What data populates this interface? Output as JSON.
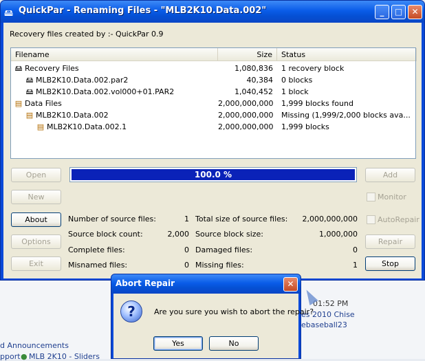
{
  "window": {
    "title": "QuickPar - Renaming Files - \"MLB2K10.Data.002\"",
    "created_by": "Recovery files created by :- QuickPar 0.9",
    "controls": {
      "minimize": "_",
      "maximize": "□",
      "close": "✕"
    }
  },
  "list": {
    "columns": {
      "filename": "Filename",
      "size": "Size",
      "status": "Status"
    },
    "rows": [
      {
        "icon": "disk-icon",
        "name": "Recovery Files",
        "size": "1,080,836",
        "status": "1 recovery block",
        "indent": 0
      },
      {
        "icon": "disk-icon",
        "name": "MLB2K10.Data.002.par2",
        "size": "40,384",
        "status": "0 blocks",
        "indent": 1
      },
      {
        "icon": "disk-icon",
        "name": "MLB2K10.Data.002.vol000+01.PAR2",
        "size": "1,040,452",
        "status": "1 block",
        "indent": 1
      },
      {
        "icon": "document-icon",
        "name": "Data Files",
        "size": "2,000,000,000",
        "status": "1,999 blocks found",
        "indent": 0
      },
      {
        "icon": "document-icon",
        "name": "MLB2K10.Data.002",
        "size": "2,000,000,000",
        "status": "Missing (1,999/2,000 blocks ava...",
        "indent": 1
      },
      {
        "icon": "document-icon",
        "name": "MLB2K10.Data.002.1",
        "size": "2,000,000,000",
        "status": "1,999 blocks",
        "indent": 2
      }
    ]
  },
  "buttons": {
    "open": "Open",
    "new": "New",
    "about": "About",
    "options": "Options",
    "exit": "Exit",
    "add": "Add",
    "repair": "Repair",
    "stop": "Stop"
  },
  "checkboxes": {
    "monitor": "Monitor",
    "autorepair": "AutoRepair"
  },
  "progress": {
    "value": 100.0,
    "label": "100.0 %"
  },
  "stats": {
    "source_files_label": "Number of source files:",
    "source_files": "1",
    "block_count_label": "Source block count:",
    "block_count": "2,000",
    "complete_label": "Complete files:",
    "complete": "0",
    "misnamed_label": "Misnamed files:",
    "misnamed": "0",
    "total_size_label": "Total size of source files:",
    "total_size": "2,000,000,000",
    "block_size_label": "Source block size:",
    "block_size": "1,000,000",
    "damaged_label": "Damaged files:",
    "damaged": "0",
    "missing_label": "Missing files:",
    "missing": "1"
  },
  "dialog": {
    "title": "Abort Repair",
    "message": "Are you sure you wish to abort the repair?",
    "yes": "Yes",
    "no": "No"
  },
  "background": {
    "time": "01:52 PM",
    "line2": "es 2010 Chise",
    "line3": "ebaseball23",
    "link1": "d Announcements",
    "link2": "pport",
    "link3": "MLB 2K10 - Sliders"
  }
}
